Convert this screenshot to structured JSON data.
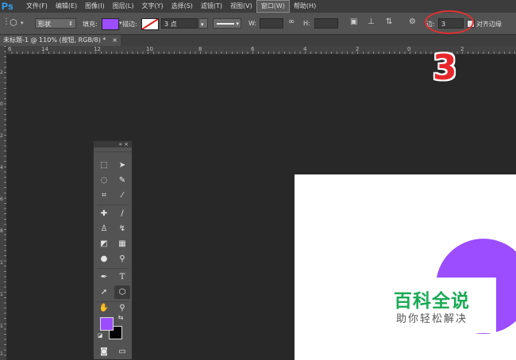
{
  "app": {
    "logo": "Ps"
  },
  "menubar": {
    "items": [
      "文件(F)",
      "编辑(E)",
      "图像(I)",
      "图层(L)",
      "文字(Y)",
      "选择(S)",
      "滤镜(T)",
      "视图(V)",
      "窗口(W)",
      "帮助(H)"
    ],
    "active": "窗口(W)"
  },
  "options": {
    "mode_value": "形状",
    "fill_label": "填充:",
    "stroke_label": "描边:",
    "stroke_width": "3 点",
    "w_label": "W:",
    "h_label": "H:",
    "sides_label": "边:",
    "sides_value": "3",
    "align_edges_label": "对齐边缘",
    "fill_color": "#9b4dff"
  },
  "document": {
    "tab_title": "未标题-1 @ 110% (按钮, RGB/8) *",
    "close_glyph": "×",
    "ruler_top": [
      "6",
      "14",
      "12",
      "10",
      "8",
      "6",
      "4",
      "2",
      "0",
      "2"
    ],
    "ruler_left": [
      "2",
      "0",
      "2",
      "4",
      "6",
      "8",
      "1",
      "1",
      "1",
      "1"
    ]
  },
  "shape": {
    "color": "#9b4dff"
  },
  "toolbox": {
    "header_glyphs": "«  ×",
    "fg_color": "#9b4dff",
    "bg_color": "#000000"
  },
  "annotation": {
    "number": "3",
    "color": "#e8272b"
  },
  "watermark": {
    "title": "百科全说",
    "subtitle": "助你轻松解决"
  }
}
